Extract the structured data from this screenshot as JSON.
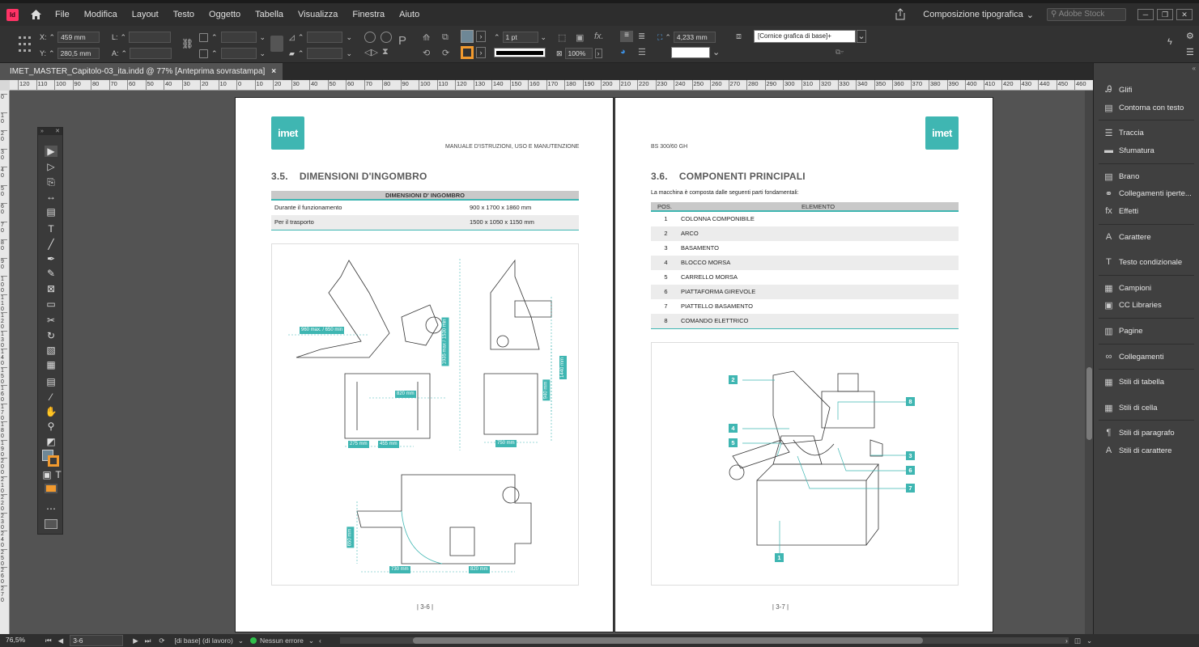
{
  "app": {
    "icon_label": "Id"
  },
  "menu": [
    "File",
    "Modifica",
    "Layout",
    "Testo",
    "Oggetto",
    "Tabella",
    "Visualizza",
    "Finestra",
    "Aiuto"
  ],
  "workspace": "Composizione tipografica",
  "search_placeholder": "Adobe Stock",
  "control": {
    "x_label": "X:",
    "x_value": "459 mm",
    "y_label": "Y:",
    "y_value": "280,5 mm",
    "w_label": "L:",
    "h_label": "A:",
    "stroke_weight": "1 pt",
    "opacity": "100%",
    "gap_value": "4,233 mm",
    "object_style": "[Cornice grafica di base]+"
  },
  "document_tab": {
    "title": "IMET_MASTER_Capitolo-03_ita.indd @ 77% [Anteprima sovrastampa]",
    "close": "×"
  },
  "ruler_h": [
    "120",
    "110",
    "100",
    "90",
    "80",
    "70",
    "60",
    "50",
    "40",
    "30",
    "20",
    "10",
    "0",
    "10",
    "20",
    "30",
    "40",
    "50",
    "60",
    "70",
    "80",
    "90",
    "100",
    "110",
    "120",
    "130",
    "140",
    "150",
    "160",
    "170",
    "180",
    "190",
    "200",
    "210",
    "220",
    "230",
    "240",
    "250",
    "260",
    "270",
    "280",
    "290",
    "300",
    "310",
    "320",
    "330",
    "340",
    "350",
    "360",
    "370",
    "380",
    "390",
    "400",
    "410",
    "420",
    "430",
    "440",
    "450",
    "460"
  ],
  "ruler_v": [
    "0",
    "1 0",
    "2 0",
    "3 0",
    "4 0",
    "5 0",
    "6 0",
    "7 0",
    "8 0",
    "9 0",
    "1 0 0",
    "1 1 0",
    "1 2 0",
    "1 3 0",
    "1 4 0",
    "1 5 0",
    "1 6 0",
    "1 7 0",
    "1 8 0",
    "1 9 0",
    "2 0 0",
    "2 1 0",
    "2 2 0",
    "2 3 0",
    "2 4 0",
    "2 5 0",
    "2 6 0",
    "2 7 0"
  ],
  "left_page": {
    "logo": "imet",
    "header": "MANUALE D'ISTRUZIONI, USO E MANUTENZIONE",
    "section_num": "3.5.",
    "section_title": "DIMENSIONI D'INGOMBRO",
    "table_header": "DIMENSIONI D' INGOMBRO",
    "rows": [
      {
        "label": "Durante il funzionamento",
        "value": "900 x 1700 x 1860 mm"
      },
      {
        "label": "Per il trasporto",
        "value": "1500 x 1050 x 1150 mm"
      }
    ],
    "dims": [
      "960 max. / 650 min",
      "820 mm",
      "275 mm",
      "455 mm",
      "1935 max / 1530 min",
      "940 mm",
      "1440 mm",
      "750 mm",
      "650 mm",
      "730 mm",
      "820 mm"
    ],
    "page_number": "3-6"
  },
  "right_page": {
    "logo": "imet",
    "header": "BS 300/60 GH",
    "section_num": "3.6.",
    "section_title": "COMPONENTI PRINCIPALI",
    "intro": "La macchina è composta dalle seguenti parti fondamentali:",
    "col_pos": "POS.",
    "col_element": "ELEMENTO",
    "rows": [
      {
        "pos": "1",
        "name": "COLONNA COMPONIBILE"
      },
      {
        "pos": "2",
        "name": "ARCO"
      },
      {
        "pos": "3",
        "name": "BASAMENTO"
      },
      {
        "pos": "4",
        "name": "BLOCCO MORSA"
      },
      {
        "pos": "5",
        "name": "CARRELLO MORSA"
      },
      {
        "pos": "6",
        "name": "PIATTAFORMA GIREVOLE"
      },
      {
        "pos": "7",
        "name": "PIATTELLO BASAMENTO"
      },
      {
        "pos": "8",
        "name": "COMANDO ELETTRICO"
      }
    ],
    "callouts": [
      "2",
      "8",
      "4",
      "5",
      "3",
      "6",
      "7",
      "1"
    ],
    "page_number": "3-7"
  },
  "panels": [
    {
      "icon": "glyphs-icon",
      "label": "Glifi"
    },
    {
      "icon": "text-wrap-icon",
      "label": "Contorna con testo"
    },
    {
      "icon": "stroke-icon",
      "label": "Traccia"
    },
    {
      "icon": "gradient-icon",
      "label": "Sfumatura"
    },
    {
      "icon": "story-icon",
      "label": "Brano"
    },
    {
      "icon": "hyperlinks-icon",
      "label": "Collegamenti iperte..."
    },
    {
      "icon": "effects-icon",
      "label": "Effetti"
    },
    {
      "icon": "character-icon",
      "label": "Carattere"
    },
    {
      "icon": "conditional-text-icon",
      "label": "Testo condizionale"
    },
    {
      "icon": "swatches-icon",
      "label": "Campioni"
    },
    {
      "icon": "cc-libraries-icon",
      "label": "CC Libraries"
    },
    {
      "icon": "pages-icon",
      "label": "Pagine"
    },
    {
      "icon": "links-icon",
      "label": "Collegamenti"
    },
    {
      "icon": "table-styles-icon",
      "label": "Stili di tabella"
    },
    {
      "icon": "cell-styles-icon",
      "label": "Stili di cella"
    },
    {
      "icon": "paragraph-styles-icon",
      "label": "Stili di paragrafo"
    },
    {
      "icon": "character-styles-icon",
      "label": "Stili di carattere"
    }
  ],
  "status": {
    "zoom": "76,5%",
    "page": "3-6",
    "profile": "[di base] (di lavoro)",
    "preflight": "Nessun errore"
  },
  "colors": {
    "accent": "#3fb6b2",
    "ui_dark": "#323232",
    "pasteboard": "#535353",
    "stroke_swatch": "#f29a2e"
  }
}
